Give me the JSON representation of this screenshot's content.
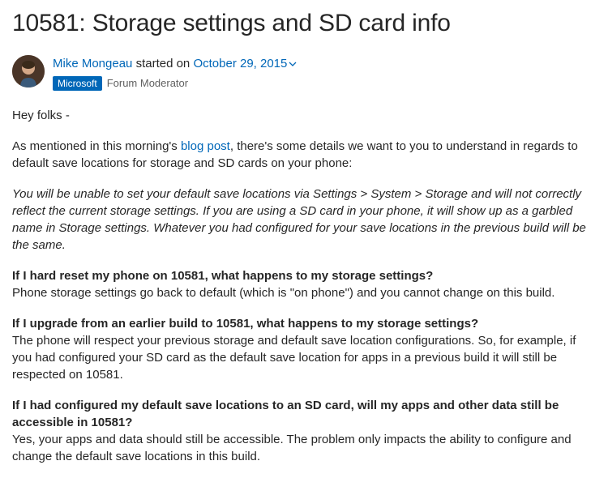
{
  "title": "10581: Storage settings and SD card info",
  "author": {
    "name": "Mike Mongeau",
    "started_text": "started on",
    "date": "October 29, 2015",
    "badge": "Microsoft",
    "role": "Forum Moderator"
  },
  "body": {
    "greeting": "Hey folks -",
    "intro_pre": "As mentioned in this morning's ",
    "intro_link": "blog post",
    "intro_post": ", there's some details we want to you to understand in regards to default save locations for storage and SD cards on your phone:",
    "italic_note": "You will be unable to set your default save locations via Settings > System > Storage and will not correctly reflect the current storage settings. If you are using a SD card in your phone, it will show up as a garbled name in Storage settings. Whatever you had configured for your save locations in the previous build will be the same.",
    "qa": [
      {
        "q": "If I hard reset my phone on 10581, what happens to my storage settings?",
        "a": "Phone storage settings go back to default (which is \"on phone\") and you cannot change on this build."
      },
      {
        "q": "If I upgrade from an earlier build to 10581, what happens to my storage settings?",
        "a": "The phone will respect your previous storage and default save location configurations. So, for example, if you had configured your SD card as the default save location for apps in a previous build it will still be respected on 10581."
      },
      {
        "q": "If I had configured my default save locations to an SD card, will my apps and other data still be accessible in 10581?",
        "a": "Yes, your apps and data should still be accessible. The problem only impacts the ability to configure and change the default save locations in this build."
      }
    ]
  }
}
